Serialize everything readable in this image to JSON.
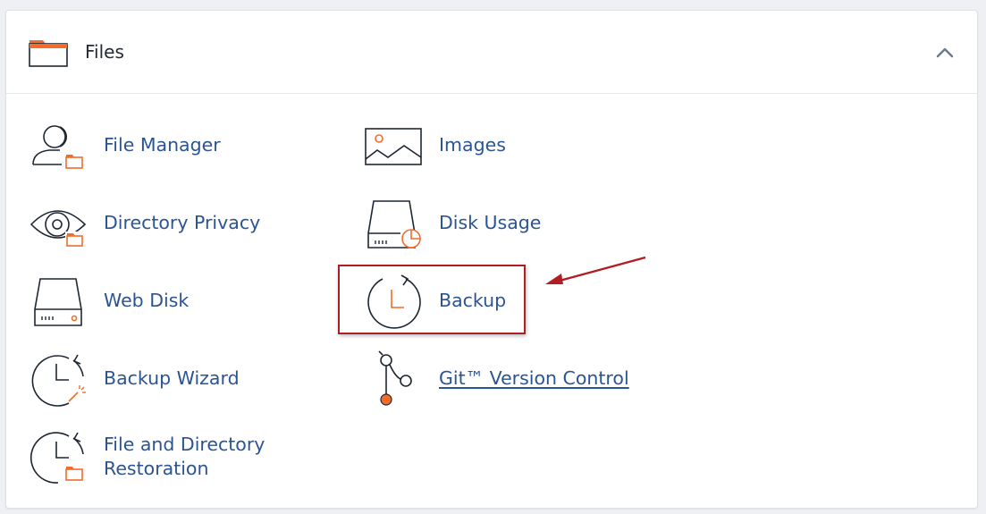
{
  "section": {
    "title": "Files",
    "collapse_icon": "chevron-up-icon"
  },
  "items": [
    {
      "id": "file-manager",
      "label": "File Manager",
      "icon": "user-folder-icon"
    },
    {
      "id": "images",
      "label": "Images",
      "icon": "image-icon"
    },
    {
      "id": "directory-privacy",
      "label": "Directory Privacy",
      "icon": "eye-folder-icon"
    },
    {
      "id": "disk-usage",
      "label": "Disk Usage",
      "icon": "disk-pie-icon"
    },
    {
      "id": "web-disk",
      "label": "Web Disk",
      "icon": "drive-icon"
    },
    {
      "id": "backup",
      "label": "Backup",
      "icon": "clock-refresh-icon"
    },
    {
      "id": "backup-wizard",
      "label": "Backup Wizard",
      "icon": "clock-wand-icon"
    },
    {
      "id": "git-version-control",
      "label": "Git™ Version Control",
      "icon": "git-branch-icon"
    },
    {
      "id": "file-directory-restoration",
      "label_line1": "File and Directory",
      "label_line2": "Restoration",
      "icon": "clock-folder-icon"
    }
  ],
  "colors": {
    "accent": "#f26c2b",
    "link": "#2b5493",
    "highlight": "#b01e23",
    "icon_stroke": "#1d2733"
  }
}
